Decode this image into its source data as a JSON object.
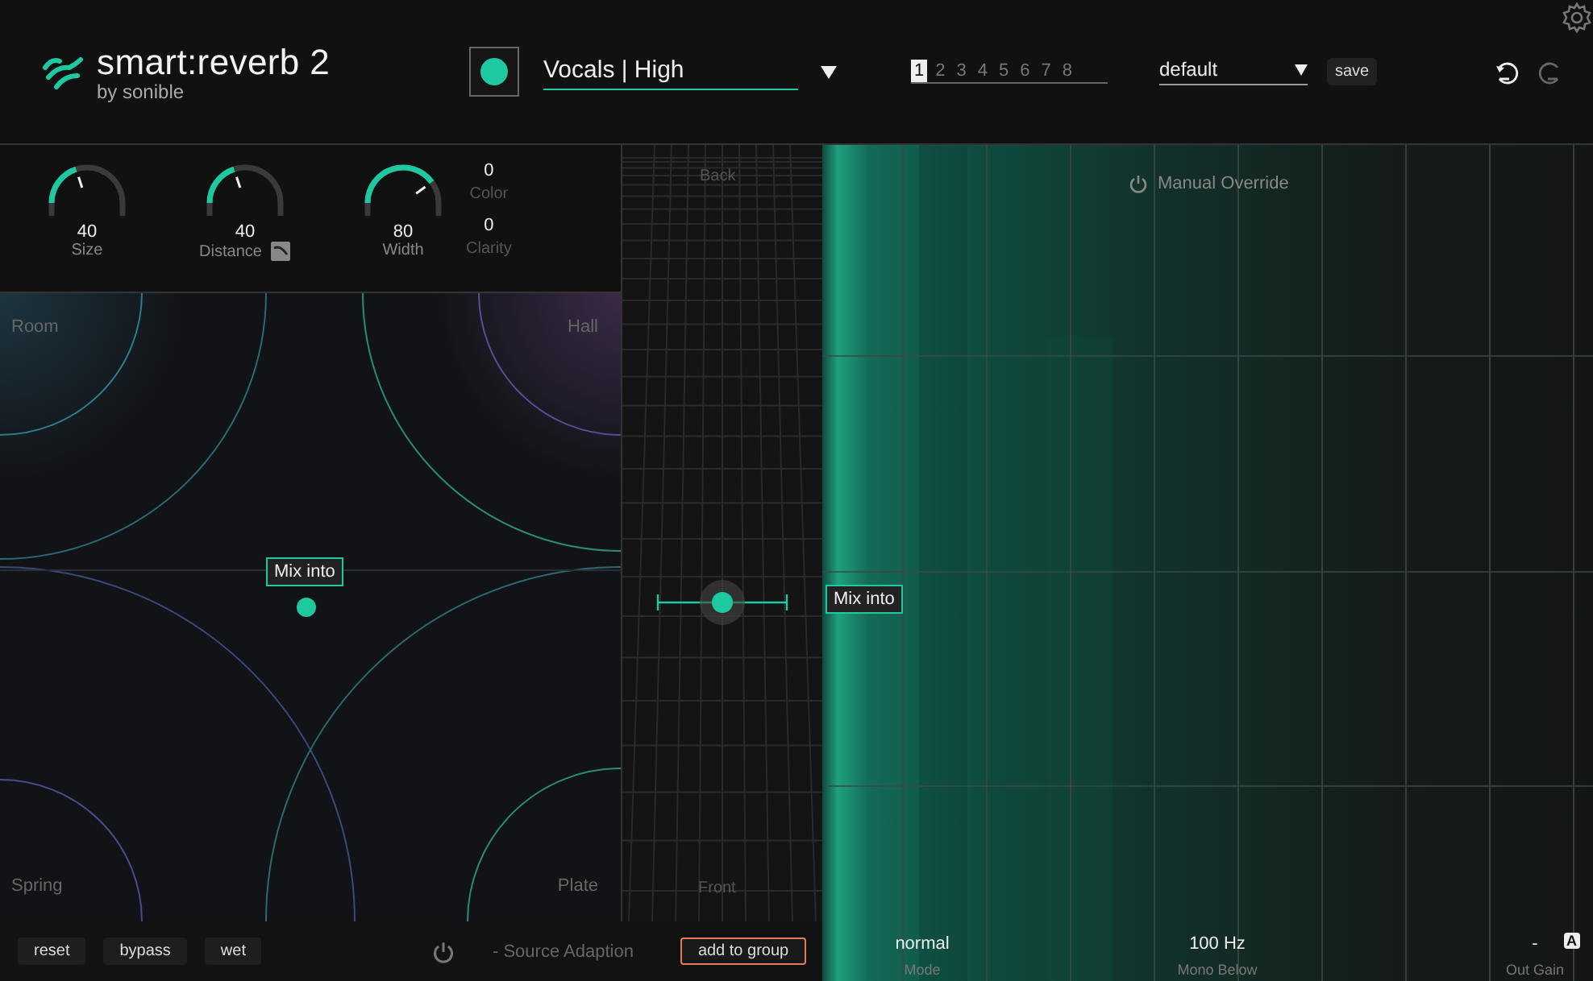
{
  "header": {
    "product": "smart:reverb 2",
    "vendor": "by sonible",
    "color": "#1fc99f",
    "preset": "Vocals | High",
    "profile": "default",
    "save": "save",
    "slots": [
      {
        "label": "1",
        "selected": true
      },
      {
        "label": "2",
        "selected": false
      },
      {
        "label": "3",
        "selected": false
      },
      {
        "label": "4",
        "selected": false
      },
      {
        "label": "5",
        "selected": false
      },
      {
        "label": "6",
        "selected": false
      },
      {
        "label": "7",
        "selected": false
      },
      {
        "label": "8",
        "selected": false
      }
    ]
  },
  "knobs": [
    {
      "label": "Size",
      "value": "40",
      "level": 0.4,
      "linked": false
    },
    {
      "label": "Distance",
      "value": "40",
      "level": 0.4,
      "linked": true
    },
    {
      "label": "Width",
      "value": "80",
      "level": 0.8,
      "linked": false
    }
  ],
  "extras": [
    {
      "label": "Color",
      "value": "0"
    },
    {
      "label": "Clarity",
      "value": "0"
    }
  ],
  "room": {
    "corners": [
      "Room",
      "Hall",
      "Spring",
      "Plate"
    ],
    "tag": "Mix into"
  },
  "depth": {
    "back": "Back",
    "front": "Front",
    "tag": "Mix into",
    "level": 0.41
  },
  "analyzer": {
    "override": "Manual Override"
  },
  "footer": {
    "buttons": [
      "reset",
      "bypass",
      "wet"
    ],
    "source_adaption": "- Source Adaption",
    "group_button": "add to group"
  },
  "readouts": [
    {
      "value": "normal",
      "label": "Mode"
    },
    {
      "value": "100 Hz",
      "label": "Mono Below"
    },
    {
      "value": "-",
      "label": "Out Gain"
    }
  ],
  "auto_badge": "A"
}
